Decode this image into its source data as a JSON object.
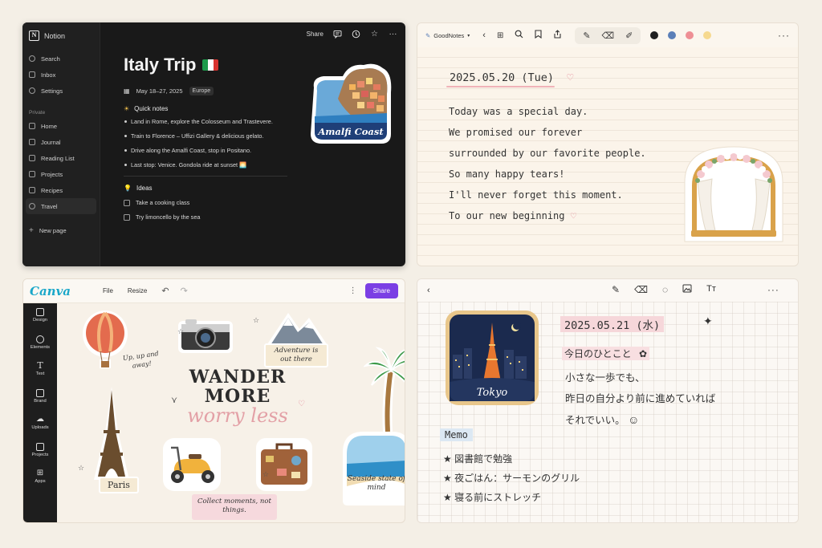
{
  "notion": {
    "app_name": "Notion",
    "sidebar": {
      "top_items": [
        {
          "label": "Search",
          "icon": "search-icon"
        },
        {
          "label": "Inbox",
          "icon": "inbox-icon"
        },
        {
          "label": "Settings",
          "icon": "gear-icon"
        }
      ],
      "section_label": "Private",
      "pages": [
        {
          "label": "Home",
          "icon": "home-icon"
        },
        {
          "label": "Journal",
          "icon": "journal-icon"
        },
        {
          "label": "Reading List",
          "icon": "book-icon"
        },
        {
          "label": "Projects",
          "icon": "folder-icon"
        },
        {
          "label": "Recipes",
          "icon": "recipe-icon"
        },
        {
          "label": "Travel",
          "icon": "globe-icon",
          "active": true
        }
      ],
      "new_page": "New page"
    },
    "topbar": {
      "share": "Share"
    },
    "page": {
      "title": "Italy Trip",
      "date": "May 18–27, 2025",
      "tag": "Europe",
      "quick_notes_heading": "Quick notes",
      "quick_notes": [
        "Land in Rome, explore the Colosseum and Trastevere.",
        "Train to Florence – Uffizi Gallery & delicious gelato.",
        "Drive along the Amalfi Coast, stop in Positano.",
        "Last stop: Venice. Gondola ride at sunset 🌅"
      ],
      "ideas_heading": "Ideas",
      "ideas": [
        "Take a cooking class",
        "Try limoncello by the sea"
      ],
      "sticker_label": "Amalfi Coast"
    }
  },
  "goodnotes": {
    "app_name": "GoodNotes",
    "pen_colors": [
      "#1f1f1f",
      "#5b7fb8",
      "#ee8f95",
      "#f6d98f"
    ],
    "date": "2025.05.20 (Tue)",
    "lines": [
      "Today was a special day.",
      "We promised our forever",
      "surrounded by our favorite people.",
      "So many happy tears!",
      "I'll never forget this moment.",
      "To our new beginning"
    ]
  },
  "canva": {
    "logo": "Canva",
    "menu": [
      "File",
      "Resize"
    ],
    "share": "Share",
    "sidebar": [
      {
        "label": "Design",
        "icon": "design-icon"
      },
      {
        "label": "Elements",
        "icon": "elements-icon"
      },
      {
        "label": "Text",
        "icon": "text-icon"
      },
      {
        "label": "Brand",
        "icon": "brand-icon"
      },
      {
        "label": "Uploads",
        "icon": "upload-icon"
      },
      {
        "label": "Projects",
        "icon": "folder-icon"
      },
      {
        "label": "Apps",
        "icon": "apps-icon"
      }
    ],
    "headline_1": "WANDER",
    "headline_2": "MORE",
    "headline_3": "worry less",
    "balloon_caption": "Up, up and away!",
    "adventure_caption": "Adventure is out there",
    "paris_caption": "Paris",
    "seaside_caption": "Seaside state of mind",
    "collect_caption": "Collect moments, not things."
  },
  "japanese": {
    "date": "2025.05.21 (水)",
    "subtitle": "今日のひとこと",
    "lines": [
      "小さな一歩でも、",
      "昨日の自分より前に進めていれば",
      "それでいい。"
    ],
    "sticker_label": "Tokyo",
    "memo_label": "Memo",
    "memo_items": [
      "★ 図書館で勉強",
      "★ 夜ごはん：サーモンのグリル",
      "★ 寝る前にストレッチ"
    ]
  }
}
